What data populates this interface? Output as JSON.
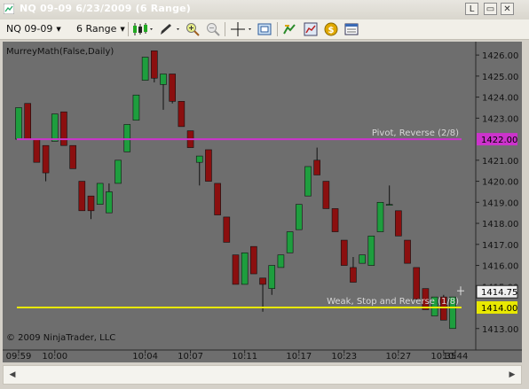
{
  "window": {
    "title": "NQ 09-09  6/23/2009 (6 Range)",
    "buttons": [
      "L",
      "▭",
      "✕"
    ]
  },
  "toolbar": {
    "instrument": "NQ 09-09",
    "period": "6 Range",
    "icons": [
      "candlestick-style-icon",
      "drawing-pen-icon",
      "zoom-in-icon",
      "zoom-out-icon",
      "crosshair-icon",
      "snapshot-icon",
      "indicators-icon",
      "strategies-icon",
      "dollar-icon",
      "data-box-icon"
    ]
  },
  "chart": {
    "indicator_label": "MurreyMath(False,Daily)",
    "copyright": "© 2009 NinjaTrader, LLC",
    "background": "#6e6e6e",
    "up_color": "#1e9e3e",
    "down_color": "#8b0f0f",
    "y_ticks": [
      "1426.00",
      "1425.00",
      "1424.00",
      "1423.00",
      "1421.00",
      "1420.00",
      "1419.00",
      "1418.00",
      "1417.00",
      "1416.00",
      "1415.00",
      "1413.00"
    ],
    "x_ticks": [
      "09:59",
      "10:00",
      "10:04",
      "10:07",
      "10:11",
      "10:17",
      "10:23",
      "10:27",
      "10:35",
      "10:44"
    ],
    "lines": [
      {
        "label": "Pivot, Reverse (2/8)",
        "price": 1422.0,
        "price_label": "1422.00",
        "color": "#cc33cc"
      },
      {
        "label": "Weak, Stop and Reverse (1/8)",
        "price": 1414.0,
        "price_label": "1414.00",
        "color": "#e8e800"
      }
    ],
    "last_price": "1414.75"
  },
  "chart_data": {
    "type": "candlestick",
    "ylim": [
      1412.4,
      1426.3
    ],
    "candles": [
      {
        "o": 1422.0,
        "h": 1423.5,
        "l": 1422.0,
        "c": 1423.5
      },
      {
        "o": 1423.7,
        "h": 1423.7,
        "l": 1422.0,
        "c": 1422.0
      },
      {
        "o": 1422.0,
        "h": 1422.0,
        "l": 1420.9,
        "c": 1420.9
      },
      {
        "o": 1421.7,
        "h": 1421.7,
        "l": 1420.0,
        "c": 1420.4
      },
      {
        "o": 1421.9,
        "h": 1423.2,
        "l": 1421.9,
        "c": 1423.2
      },
      {
        "o": 1423.3,
        "h": 1423.3,
        "l": 1421.7,
        "c": 1421.7
      },
      {
        "o": 1421.7,
        "h": 1421.7,
        "l": 1420.6,
        "c": 1420.6
      },
      {
        "o": 1420.0,
        "h": 1420.0,
        "l": 1418.6,
        "c": 1418.6
      },
      {
        "o": 1419.3,
        "h": 1419.3,
        "l": 1418.2,
        "c": 1418.6
      },
      {
        "o": 1418.9,
        "h": 1419.9,
        "l": 1418.9,
        "c": 1419.9
      },
      {
        "o": 1418.5,
        "h": 1419.9,
        "l": 1418.5,
        "c": 1419.5
      },
      {
        "o": 1419.9,
        "h": 1421.0,
        "l": 1419.9,
        "c": 1421.0
      },
      {
        "o": 1421.4,
        "h": 1422.7,
        "l": 1421.4,
        "c": 1422.7
      },
      {
        "o": 1422.9,
        "h": 1424.1,
        "l": 1422.9,
        "c": 1424.1
      },
      {
        "o": 1424.8,
        "h": 1425.9,
        "l": 1424.8,
        "c": 1425.9
      },
      {
        "o": 1426.2,
        "h": 1426.2,
        "l": 1424.7,
        "c": 1424.9
      },
      {
        "o": 1424.6,
        "h": 1425.1,
        "l": 1423.4,
        "c": 1425.1
      },
      {
        "o": 1425.1,
        "h": 1425.1,
        "l": 1423.7,
        "c": 1423.8
      },
      {
        "o": 1423.8,
        "h": 1423.8,
        "l": 1422.6,
        "c": 1422.6
      },
      {
        "o": 1422.4,
        "h": 1422.4,
        "l": 1421.6,
        "c": 1421.6
      },
      {
        "o": 1420.9,
        "h": 1421.2,
        "l": 1419.8,
        "c": 1421.2
      },
      {
        "o": 1421.5,
        "h": 1421.5,
        "l": 1420.0,
        "c": 1420.0
      },
      {
        "o": 1419.9,
        "h": 1419.9,
        "l": 1418.4,
        "c": 1418.4
      },
      {
        "o": 1418.3,
        "h": 1418.3,
        "l": 1417.1,
        "c": 1417.1
      },
      {
        "o": 1416.5,
        "h": 1416.5,
        "l": 1415.1,
        "c": 1415.1
      },
      {
        "o": 1415.1,
        "h": 1416.6,
        "l": 1415.1,
        "c": 1416.6
      },
      {
        "o": 1416.9,
        "h": 1416.9,
        "l": 1415.6,
        "c": 1415.6
      },
      {
        "o": 1415.4,
        "h": 1415.4,
        "l": 1413.8,
        "c": 1415.1
      },
      {
        "o": 1414.9,
        "h": 1416.0,
        "l": 1414.6,
        "c": 1416.0
      },
      {
        "o": 1415.9,
        "h": 1416.5,
        "l": 1415.9,
        "c": 1416.5
      },
      {
        "o": 1416.6,
        "h": 1417.6,
        "l": 1416.6,
        "c": 1417.6
      },
      {
        "o": 1417.7,
        "h": 1418.9,
        "l": 1417.7,
        "c": 1418.9
      },
      {
        "o": 1419.3,
        "h": 1420.7,
        "l": 1419.3,
        "c": 1420.7
      },
      {
        "o": 1421.0,
        "h": 1421.6,
        "l": 1420.3,
        "c": 1420.3
      },
      {
        "o": 1420.0,
        "h": 1420.0,
        "l": 1418.7,
        "c": 1418.7
      },
      {
        "o": 1418.7,
        "h": 1418.7,
        "l": 1417.6,
        "c": 1417.6
      },
      {
        "o": 1417.2,
        "h": 1417.2,
        "l": 1416.0,
        "c": 1416.0
      },
      {
        "o": 1415.9,
        "h": 1416.4,
        "l": 1415.2,
        "c": 1415.2
      },
      {
        "o": 1416.1,
        "h": 1416.5,
        "l": 1416.1,
        "c": 1416.5
      },
      {
        "o": 1416.0,
        "h": 1417.4,
        "l": 1416.0,
        "c": 1417.4
      },
      {
        "o": 1417.6,
        "h": 1419.0,
        "l": 1417.6,
        "c": 1419.0
      },
      {
        "o": 1418.9,
        "h": 1419.8,
        "l": 1418.9,
        "c": 1418.9
      },
      {
        "o": 1418.6,
        "h": 1418.6,
        "l": 1417.4,
        "c": 1417.4
      },
      {
        "o": 1417.2,
        "h": 1417.2,
        "l": 1416.1,
        "c": 1416.1
      },
      {
        "o": 1415.9,
        "h": 1415.9,
        "l": 1414.4,
        "c": 1414.4
      },
      {
        "o": 1414.9,
        "h": 1414.9,
        "l": 1413.9,
        "c": 1413.9
      },
      {
        "o": 1413.6,
        "h": 1414.5,
        "l": 1413.6,
        "c": 1414.5
      },
      {
        "o": 1414.5,
        "h": 1414.6,
        "l": 1413.4,
        "c": 1413.4
      },
      {
        "o": 1413.0,
        "h": 1414.5,
        "l": 1413.0,
        "c": 1414.5
      }
    ]
  }
}
